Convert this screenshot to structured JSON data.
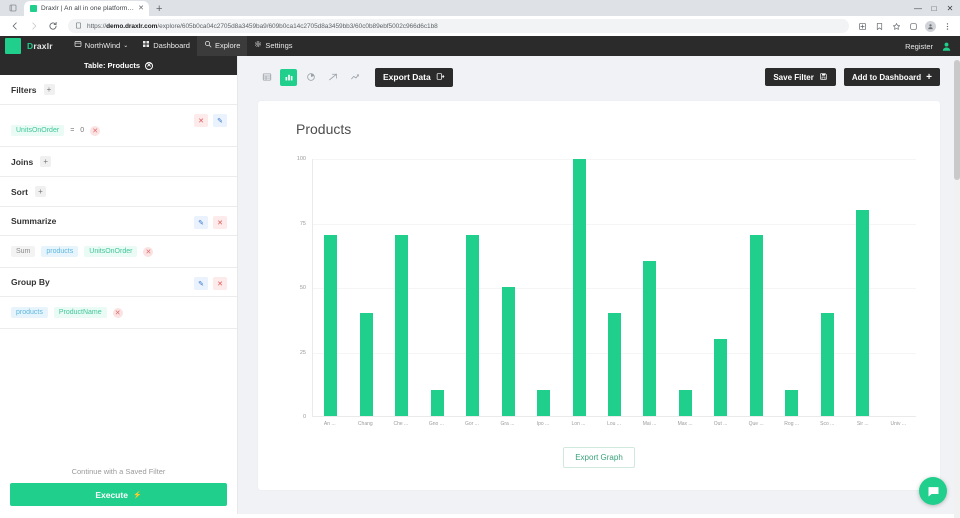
{
  "browser": {
    "tab": {
      "title": "Draxlr | An all in one platform t...",
      "favicon": "draxlr-logo-icon",
      "close": "✕"
    },
    "new_tab": "+",
    "window_controls": [
      "—",
      "□",
      "✕"
    ],
    "nav": {
      "back": "←",
      "forward": "→",
      "reload": "⟳"
    },
    "omnibox": {
      "lock_icon": "page-info-icon",
      "url_prefix": "https://",
      "url_domain": "demo.draxlr.com",
      "url_path": "/explore/605b0ca04c2705d8a3459ba9/609b0ca14c2705d8a3459bb3/60c0b89ebf5002c966d6c1b8"
    },
    "right_icons": [
      "share-icon",
      "bookmark-ribbon-icon",
      "star-icon",
      "extensions-icon",
      "profile-avatar-icon",
      "menu-icon"
    ]
  },
  "appbar": {
    "logo": "draxlr-logo-icon",
    "brand_accent": "D",
    "brand_rest": "raxlr",
    "items": [
      {
        "label": "NorthWind",
        "icon": "database-icon",
        "caret": "⌄",
        "active": false
      },
      {
        "label": "Dashboard",
        "icon": "dashboard-grid-icon",
        "active": false
      },
      {
        "label": "Explore",
        "icon": "magnifier-icon",
        "active": true
      },
      {
        "label": "Settings",
        "icon": "gear-icon",
        "active": false
      }
    ],
    "register": "Register",
    "user_icon": "user-avatar-icon"
  },
  "sidebar": {
    "table_header": {
      "label": "Table: Products",
      "close_icon": "✕"
    },
    "sections": [
      {
        "name": "filters",
        "title": "Filters",
        "add": "+"
      },
      {
        "name": "joins",
        "title": "Joins",
        "add": "+"
      },
      {
        "name": "sort",
        "title": "Sort",
        "add": "+"
      },
      {
        "name": "summarize",
        "title": "Summarize",
        "edit": "✎",
        "delete": "✕"
      },
      {
        "name": "group-by",
        "title": "Group By",
        "edit": "✎",
        "delete": "✕"
      }
    ],
    "filter_rule": {
      "field": "UnitsOnOrder",
      "operator": "=",
      "value": "0",
      "remove": "✕",
      "edit": "✎",
      "delete": "✕"
    },
    "summarize_rule": {
      "aggregate": "Sum",
      "table": "products",
      "column": "UnitsOnOrder",
      "remove": "✕"
    },
    "group_by_rule": {
      "table": "products",
      "column": "ProductName",
      "remove": "✕"
    },
    "saved_filter_link": "Continue with a Saved Filter",
    "execute_button": {
      "label": "Execute",
      "icon": "⚡"
    }
  },
  "content": {
    "viz_tabs": [
      {
        "name": "table",
        "icon": "table-grid-icon",
        "active": false
      },
      {
        "name": "bar",
        "icon": "bar-chart-icon",
        "active": true
      },
      {
        "name": "pie",
        "icon": "pie-chart-icon",
        "active": false
      },
      {
        "name": "line",
        "icon": "line-chart-icon",
        "active": false
      },
      {
        "name": "area",
        "icon": "area-chart-icon",
        "active": false
      }
    ],
    "export_data": {
      "label": "Export Data",
      "icon": "export-icon"
    },
    "save_filter": {
      "label": "Save Filter",
      "icon": "floppy-save-icon"
    },
    "add_to_dashboard": {
      "label": "Add to Dashboard",
      "icon": "+"
    },
    "export_graph": {
      "label": "Export Graph"
    },
    "chat_icon": "chat-bubble-icon",
    "accent_color": "#21cf8d",
    "dark_color": "#2b2b2b"
  },
  "chart_data": {
    "type": "bar",
    "title": "Products",
    "xlabel": "",
    "ylabel": "",
    "ylim": [
      0,
      100
    ],
    "yticks": [
      0,
      25,
      50,
      75,
      100
    ],
    "grid": true,
    "legend": false,
    "bar_color": "#21cf8d",
    "categories": [
      "An ...",
      "Chang",
      "Che ...",
      "Gno ...",
      "Gor ...",
      "Gra ...",
      "Ipo ...",
      "Lon ...",
      "Lou ...",
      "Mai ...",
      "Max ...",
      "Out ...",
      "Que ...",
      "Rog ...",
      "Sco ...",
      "Sir ...",
      "Univ ..."
    ],
    "values": [
      70,
      40,
      70,
      10,
      70,
      50,
      10,
      100,
      40,
      60,
      10,
      30,
      70,
      10,
      40,
      80,
      0
    ],
    "bar_count": 17
  }
}
